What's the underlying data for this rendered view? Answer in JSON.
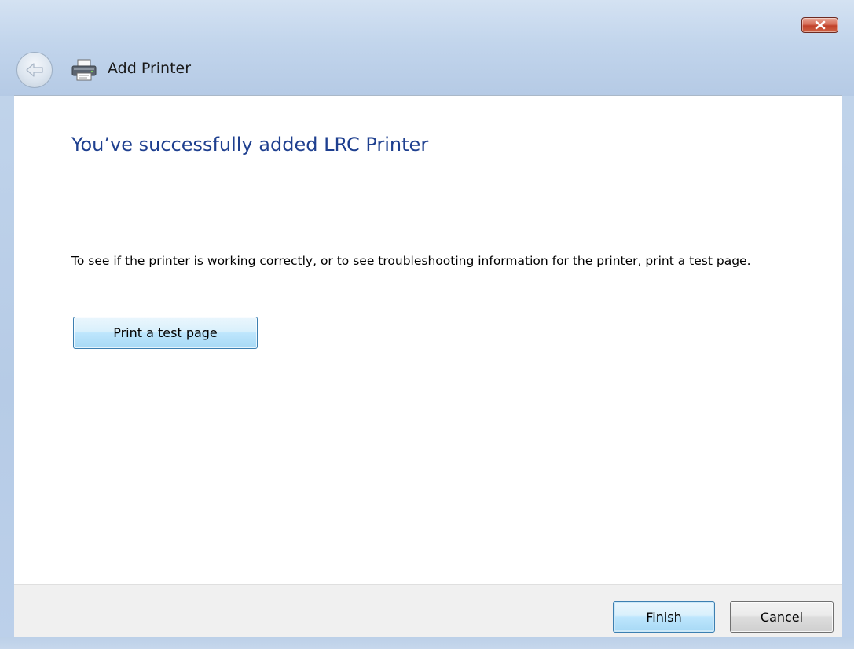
{
  "window": {
    "title": "Add Printer"
  },
  "main": {
    "heading": "You’ve successfully added LRC Printer",
    "description": "To see if the printer is working correctly, or to see troubleshooting information for the printer, print a test page.",
    "test_page_button": "Print a test page"
  },
  "footer": {
    "finish_label": "Finish",
    "cancel_label": "Cancel"
  },
  "icons": {
    "close": "close-icon",
    "back": "back-arrow-icon",
    "printer": "printer-icon"
  },
  "colors": {
    "heading": "#1e3f8f",
    "close_button": "#c0412a",
    "frame": "#c3d6ec"
  }
}
